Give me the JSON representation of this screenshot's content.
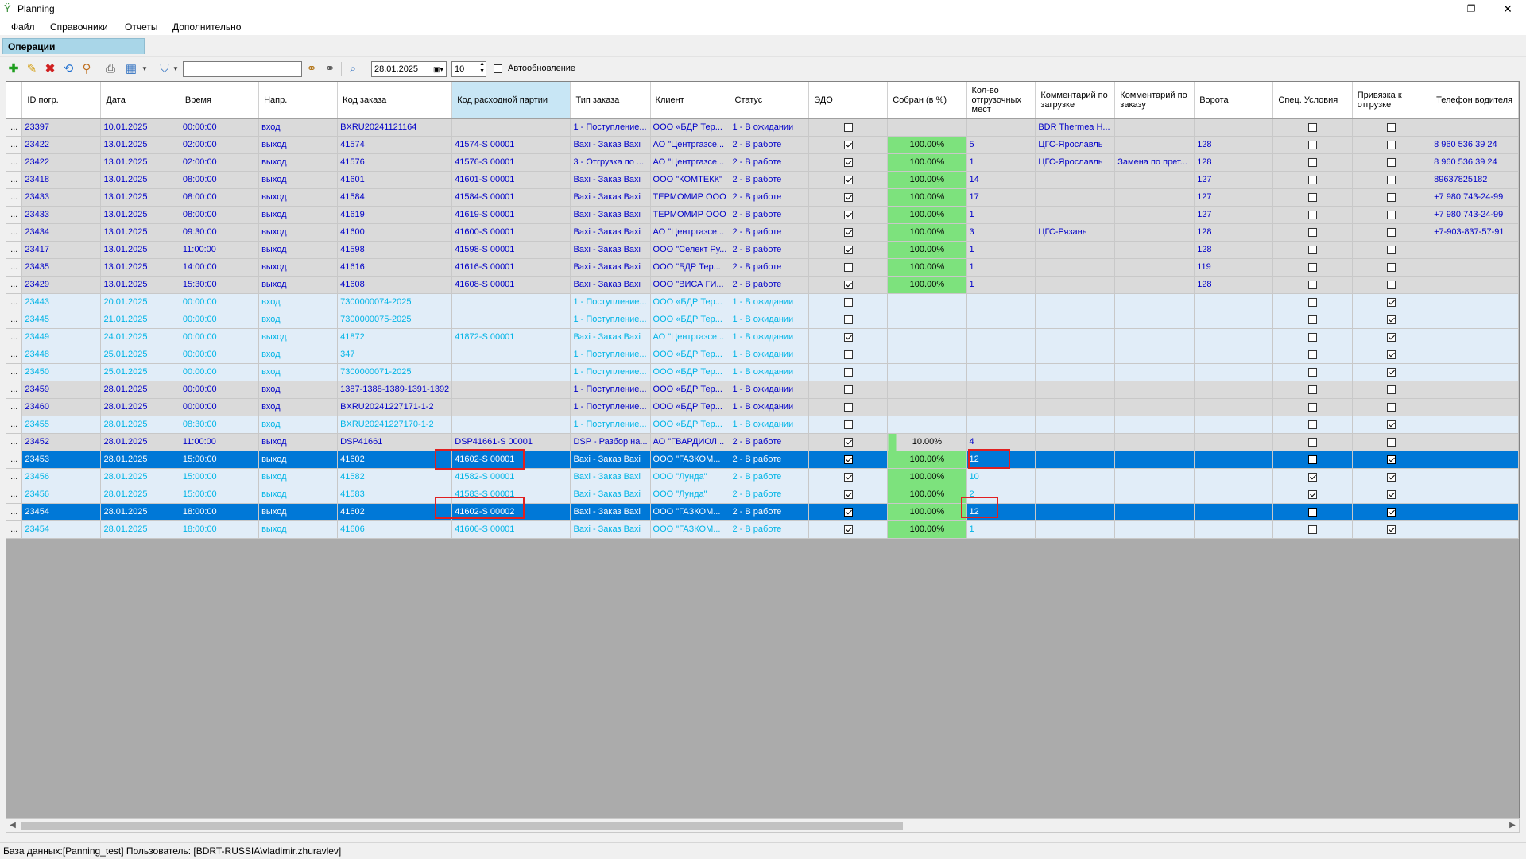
{
  "window": {
    "title": "Planning",
    "minimize": "—",
    "maximize": "❐",
    "close": "✕"
  },
  "menu": [
    "Файл",
    "Справочники",
    "Отчеты",
    "Дополнительно"
  ],
  "tab": "Операции",
  "toolbar": {
    "search_value": "",
    "date": "28.01.2025",
    "count": "10",
    "autoupdate_label": "Автообновление",
    "autoupdate_checked": false
  },
  "columns": [
    "ID погр.",
    "Дата",
    "Время",
    "Напр.",
    "Код заказа",
    "Код расходной партии",
    "Тип заказа",
    "Клиент",
    "Статус",
    "ЭДО",
    "Собран (в %)",
    "Кол-во отгрузочных мест",
    "Комментарий по загрузке",
    "Комментарий по заказу",
    "Ворота",
    "Спец. Условия",
    "Привязка к отгрузке",
    "Телефон водителя"
  ],
  "rows": [
    {
      "style": "dark",
      "id": "23397",
      "date": "10.01.2025",
      "time": "00:00:00",
      "dir": "вход",
      "order": "BXRU20241121164",
      "batch": "",
      "type": "1 - Поступление...",
      "client": "ООО «БДР Тер...",
      "status": "1 - В ожидании",
      "edo": false,
      "pct": "",
      "places": "",
      "cmt_load": "BDR Thermea H...",
      "cmt_order": "",
      "gate": "",
      "spec": false,
      "link": false,
      "phone": ""
    },
    {
      "style": "dark",
      "id": "23422",
      "date": "13.01.2025",
      "time": "02:00:00",
      "dir": "выход",
      "order": "41574",
      "batch": "41574-S 00001",
      "type": "Baxi - Заказ Baxi",
      "client": "АО \"Центргазсе...",
      "status": "2 - В работе",
      "edo": true,
      "pct": "100.00%",
      "places": "5",
      "cmt_load": "ЦГС-Ярославль",
      "cmt_order": "",
      "gate": "128",
      "spec": false,
      "link": false,
      "phone": "8 960 536 39 24"
    },
    {
      "style": "dark",
      "id": "23422",
      "date": "13.01.2025",
      "time": "02:00:00",
      "dir": "выход",
      "order": "41576",
      "batch": "41576-S 00001",
      "type": "3 - Отгрузка по ...",
      "client": "АО \"Центргазсе...",
      "status": "2 - В работе",
      "edo": true,
      "pct": "100.00%",
      "places": "1",
      "cmt_load": "ЦГС-Ярославль",
      "cmt_order": "Замена по прет...",
      "gate": "128",
      "spec": false,
      "link": false,
      "phone": "8 960 536 39 24"
    },
    {
      "style": "dark",
      "id": "23418",
      "date": "13.01.2025",
      "time": "08:00:00",
      "dir": "выход",
      "order": "41601",
      "batch": "41601-S 00001",
      "type": "Baxi - Заказ Baxi",
      "client": "ООО \"КОМТЕКК\"",
      "status": "2 - В работе",
      "edo": true,
      "pct": "100.00%",
      "places": "14",
      "cmt_load": "",
      "cmt_order": "",
      "gate": "127",
      "spec": false,
      "link": false,
      "phone": "89637825182"
    },
    {
      "style": "dark",
      "id": "23433",
      "date": "13.01.2025",
      "time": "08:00:00",
      "dir": "выход",
      "order": "41584",
      "batch": "41584-S 00001",
      "type": "Baxi - Заказ Baxi",
      "client": "ТЕРМОМИР ООО",
      "status": "2 - В работе",
      "edo": true,
      "pct": "100.00%",
      "places": "17",
      "cmt_load": "",
      "cmt_order": "",
      "gate": "127",
      "spec": false,
      "link": false,
      "phone": "+7 980 743-24-99"
    },
    {
      "style": "dark",
      "id": "23433",
      "date": "13.01.2025",
      "time": "08:00:00",
      "dir": "выход",
      "order": "41619",
      "batch": "41619-S 00001",
      "type": "Baxi - Заказ Baxi",
      "client": "ТЕРМОМИР ООО",
      "status": "2 - В работе",
      "edo": true,
      "pct": "100.00%",
      "places": "1",
      "cmt_load": "",
      "cmt_order": "",
      "gate": "127",
      "spec": false,
      "link": false,
      "phone": "+7 980 743-24-99"
    },
    {
      "style": "dark",
      "id": "23434",
      "date": "13.01.2025",
      "time": "09:30:00",
      "dir": "выход",
      "order": "41600",
      "batch": "41600-S 00001",
      "type": "Baxi - Заказ Baxi",
      "client": "АО \"Центргазсе...",
      "status": "2 - В работе",
      "edo": true,
      "pct": "100.00%",
      "places": "3",
      "cmt_load": "ЦГС-Рязань",
      "cmt_order": "",
      "gate": "128",
      "spec": false,
      "link": false,
      "phone": "+7-903-837-57-91"
    },
    {
      "style": "dark",
      "id": "23417",
      "date": "13.01.2025",
      "time": "11:00:00",
      "dir": "выход",
      "order": "41598",
      "batch": "41598-S 00001",
      "type": "Baxi - Заказ Baxi",
      "client": "ООО \"Селект Ру...",
      "status": "2 - В работе",
      "edo": true,
      "pct": "100.00%",
      "places": "1",
      "cmt_load": "",
      "cmt_order": "",
      "gate": "128",
      "spec": false,
      "link": false,
      "phone": ""
    },
    {
      "style": "dark",
      "id": "23435",
      "date": "13.01.2025",
      "time": "14:00:00",
      "dir": "выход",
      "order": "41616",
      "batch": "41616-S 00001",
      "type": "Baxi - Заказ Baxi",
      "client": "ООО \"БДР Тер...",
      "status": "2 - В работе",
      "edo": false,
      "pct": "100.00%",
      "places": "1",
      "cmt_load": "",
      "cmt_order": "",
      "gate": "119",
      "spec": false,
      "link": false,
      "phone": ""
    },
    {
      "style": "dark",
      "id": "23429",
      "date": "13.01.2025",
      "time": "15:30:00",
      "dir": "выход",
      "order": "41608",
      "batch": "41608-S 00001",
      "type": "Baxi - Заказ Baxi",
      "client": "ООО \"ВИСА ГИ...",
      "status": "2 - В работе",
      "edo": true,
      "pct": "100.00%",
      "places": "1",
      "cmt_load": "",
      "cmt_order": "",
      "gate": "128",
      "spec": false,
      "link": false,
      "phone": ""
    },
    {
      "style": "light",
      "id": "23443",
      "date": "20.01.2025",
      "time": "00:00:00",
      "dir": "вход",
      "order": "7300000074-2025",
      "batch": "",
      "type": "1 - Поступление...",
      "client": "ООО «БДР Тер...",
      "status": "1 - В ожидании",
      "edo": false,
      "pct": "",
      "places": "",
      "cmt_load": "",
      "cmt_order": "",
      "gate": "",
      "spec": false,
      "link": true,
      "phone": ""
    },
    {
      "style": "light",
      "id": "23445",
      "date": "21.01.2025",
      "time": "00:00:00",
      "dir": "вход",
      "order": "7300000075-2025",
      "batch": "",
      "type": "1 - Поступление...",
      "client": "ООО «БДР Тер...",
      "status": "1 - В ожидании",
      "edo": false,
      "pct": "",
      "places": "",
      "cmt_load": "",
      "cmt_order": "",
      "gate": "",
      "spec": false,
      "link": true,
      "phone": ""
    },
    {
      "style": "light",
      "id": "23449",
      "date": "24.01.2025",
      "time": "00:00:00",
      "dir": "выход",
      "order": "41872",
      "batch": "41872-S 00001",
      "type": "Baxi - Заказ Baxi",
      "client": "АО \"Центргазсе...",
      "status": "1 - В ожидании",
      "edo": true,
      "pct": "",
      "places": "",
      "cmt_load": "",
      "cmt_order": "",
      "gate": "",
      "spec": false,
      "link": true,
      "phone": ""
    },
    {
      "style": "light",
      "id": "23448",
      "date": "25.01.2025",
      "time": "00:00:00",
      "dir": "вход",
      "order": "347",
      "batch": "",
      "type": "1 - Поступление...",
      "client": "ООО «БДР Тер...",
      "status": "1 - В ожидании",
      "edo": false,
      "pct": "",
      "places": "",
      "cmt_load": "",
      "cmt_order": "",
      "gate": "",
      "spec": false,
      "link": true,
      "phone": ""
    },
    {
      "style": "light",
      "id": "23450",
      "date": "25.01.2025",
      "time": "00:00:00",
      "dir": "вход",
      "order": "7300000071-2025",
      "batch": "",
      "type": "1 - Поступление...",
      "client": "ООО «БДР Тер...",
      "status": "1 - В ожидании",
      "edo": false,
      "pct": "",
      "places": "",
      "cmt_load": "",
      "cmt_order": "",
      "gate": "",
      "spec": false,
      "link": true,
      "phone": ""
    },
    {
      "style": "dark",
      "id": "23459",
      "date": "28.01.2025",
      "time": "00:00:00",
      "dir": "вход",
      "order": "1387-1388-1389-1391-1392",
      "batch": "",
      "type": "1 - Поступление...",
      "client": "ООО «БДР Тер...",
      "status": "1 - В ожидании",
      "edo": false,
      "pct": "",
      "places": "",
      "cmt_load": "",
      "cmt_order": "",
      "gate": "",
      "spec": false,
      "link": false,
      "phone": ""
    },
    {
      "style": "dark",
      "id": "23460",
      "date": "28.01.2025",
      "time": "00:00:00",
      "dir": "вход",
      "order": "BXRU20241227171-1-2",
      "batch": "",
      "type": "1 - Поступление...",
      "client": "ООО «БДР Тер...",
      "status": "1 - В ожидании",
      "edo": false,
      "pct": "",
      "places": "",
      "cmt_load": "",
      "cmt_order": "",
      "gate": "",
      "spec": false,
      "link": false,
      "phone": ""
    },
    {
      "style": "light",
      "id": "23455",
      "date": "28.01.2025",
      "time": "08:30:00",
      "dir": "вход",
      "order": "BXRU20241227170-1-2",
      "batch": "",
      "type": "1 - Поступление...",
      "client": "ООО «БДР Тер...",
      "status": "1 - В ожидании",
      "edo": false,
      "pct": "",
      "places": "",
      "cmt_load": "",
      "cmt_order": "",
      "gate": "",
      "spec": false,
      "link": true,
      "phone": ""
    },
    {
      "style": "dark",
      "id": "23452",
      "date": "28.01.2025",
      "time": "11:00:00",
      "dir": "выход",
      "order": "DSP41661",
      "batch": "DSP41661-S 00001",
      "type": "DSP - Разбор на...",
      "client": "АО \"ГВАРДИОЛ...",
      "status": "2 - В работе",
      "edo": true,
      "pct": "10.00%",
      "pct_partial": true,
      "places": "4",
      "cmt_load": "",
      "cmt_order": "",
      "gate": "",
      "spec": false,
      "link": false,
      "phone": ""
    },
    {
      "style": "selected",
      "id": "23453",
      "date": "28.01.2025",
      "time": "15:00:00",
      "dir": "выход",
      "order": "41602",
      "batch": "41602-S 00001",
      "type": "Baxi - Заказ Baxi",
      "client": "ООО \"ГАЗКОМ...",
      "status": "2 - В работе",
      "edo": true,
      "pct": "100.00%",
      "places": "12",
      "cmt_load": "",
      "cmt_order": "",
      "gate": "",
      "spec": false,
      "link": true,
      "phone": ""
    },
    {
      "style": "light",
      "id": "23456",
      "date": "28.01.2025",
      "time": "15:00:00",
      "dir": "выход",
      "order": "41582",
      "batch": "41582-S 00001",
      "type": "Baxi - Заказ Baxi",
      "client": "ООО \"Лунда\"",
      "status": "2 - В работе",
      "edo": true,
      "pct": "100.00%",
      "places": "10",
      "cmt_load": "",
      "cmt_order": "",
      "gate": "",
      "spec": true,
      "link": true,
      "phone": ""
    },
    {
      "style": "light",
      "id": "23456",
      "date": "28.01.2025",
      "time": "15:00:00",
      "dir": "выход",
      "order": "41583",
      "batch": "41583-S 00001",
      "type": "Baxi - Заказ Baxi",
      "client": "ООО \"Лунда\"",
      "status": "2 - В работе",
      "edo": true,
      "pct": "100.00%",
      "places": "2",
      "cmt_load": "",
      "cmt_order": "",
      "gate": "",
      "spec": true,
      "link": true,
      "phone": ""
    },
    {
      "style": "selected",
      "id": "23454",
      "date": "28.01.2025",
      "time": "18:00:00",
      "dir": "выход",
      "order": "41602",
      "batch": "41602-S 00002",
      "type": "Baxi - Заказ Baxi",
      "client": "ООО \"ГАЗКОМ...",
      "status": "2 - В работе",
      "edo": true,
      "pct": "100.00%",
      "places": "12",
      "cmt_load": "",
      "cmt_order": "",
      "gate": "",
      "spec": false,
      "link": true,
      "phone": ""
    },
    {
      "style": "light",
      "id": "23454",
      "date": "28.01.2025",
      "time": "18:00:00",
      "dir": "выход",
      "order": "41606",
      "batch": "41606-S 00001",
      "type": "Baxi - Заказ Baxi",
      "client": "ООО \"ГАЗКОМ...",
      "status": "2 - В работе",
      "edo": true,
      "pct": "100.00%",
      "places": "1",
      "cmt_load": "",
      "cmt_order": "",
      "gate": "",
      "spec": false,
      "link": true,
      "phone": ""
    }
  ],
  "statusbar": "База данных:[Panning_test] Пользователь: [BDRT-RUSSIA\\vladimir.zhuravlev]",
  "colors": {
    "selected": "#0078d7",
    "pct_green": "#7de27d",
    "row_dark_text": "#0000c8",
    "row_light_text": "#00b4e6",
    "annotation_red": "#e02020",
    "tab_blue": "#a9d6e8"
  }
}
